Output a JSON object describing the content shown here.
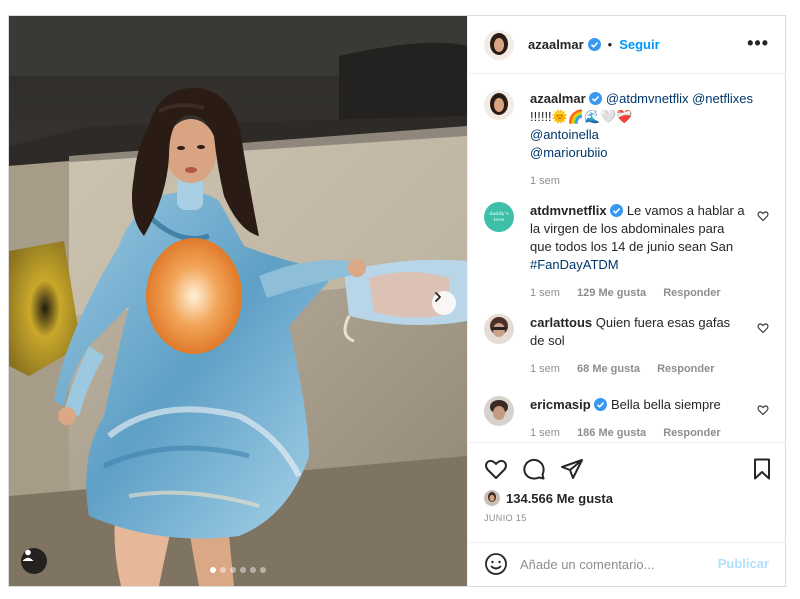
{
  "post": {
    "author": "azaalmar",
    "follow_label": "Seguir",
    "more_label": "•••",
    "carousel_dots": 6,
    "carousel_active": 0
  },
  "caption": {
    "username": "azaalmar",
    "text_mention1": "@atdmvnetflix",
    "text_mention2": "@netflixes",
    "text_emoji": "!!!!!!🌞🌈🌊🤍❤️‍🩹",
    "mention3": "@antoinella",
    "mention4": "@mariorubiio",
    "time": "1 sem"
  },
  "comments": [
    {
      "username": "atdmvnetflix",
      "verified": true,
      "text": "Le vamos a hablar a la virgen de los abdominales para que todos los 14 de junio sean San",
      "hashtag": "#FanDayATDM",
      "time": "1 sem",
      "likes": "129 Me gusta",
      "reply": "Responder",
      "avatar_text": "daddy’s love"
    },
    {
      "username": "carlattous",
      "verified": false,
      "text": "Quien fuera esas gafas de sol",
      "time": "1 sem",
      "likes": "68 Me gusta",
      "reply": "Responder"
    },
    {
      "username": "ericmasip",
      "verified": true,
      "text": "Bella bella siempre",
      "time": "1 sem",
      "likes": "186 Me gusta",
      "reply": "Responder"
    }
  ],
  "actions": {
    "likes_count": "134.566 Me gusta",
    "date": "JUNIO 15"
  },
  "add_comment": {
    "placeholder": "Añade un comentario...",
    "publish_label": "Publicar"
  },
  "icons": {
    "like": "heart-icon",
    "comment": "comment-icon",
    "share": "share-icon",
    "save": "bookmark-icon",
    "emoji": "emoji-icon",
    "tag": "user-tag-icon",
    "next": "chevron-right-icon"
  },
  "colors": {
    "accent": "#0095f6",
    "verified": "#3897f0",
    "muted": "#8e8e8e",
    "link": "#00376b",
    "publish_disabled": "#b2dffc"
  }
}
